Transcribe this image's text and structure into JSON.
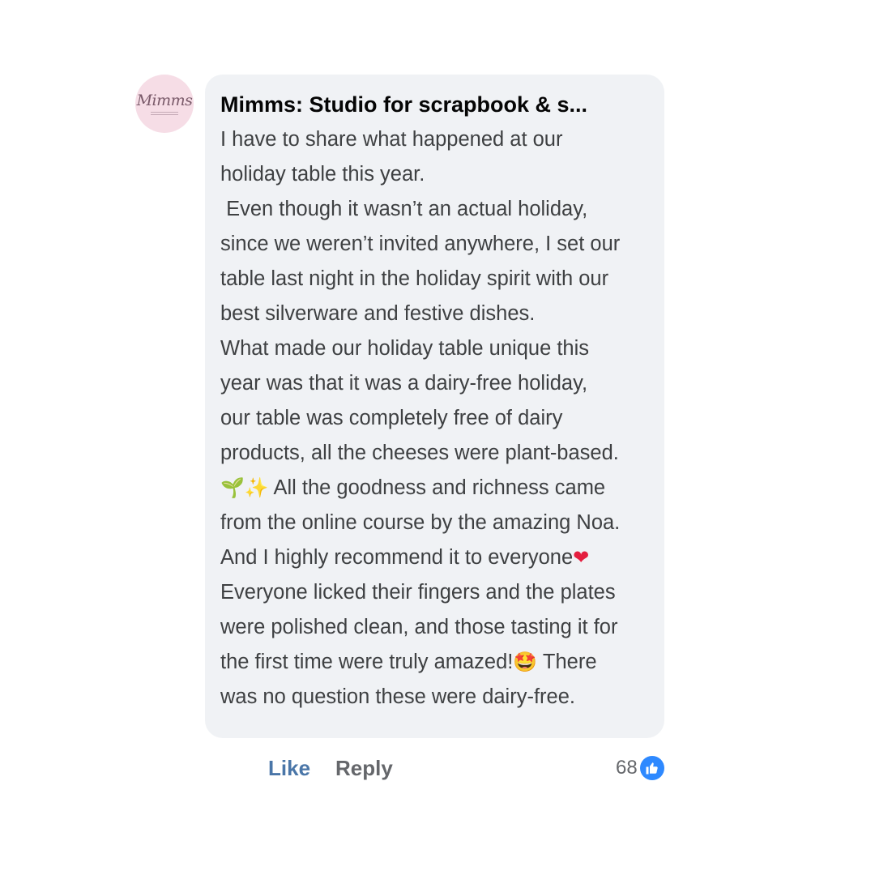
{
  "comment": {
    "avatar": {
      "logo_text": "Mimms",
      "icon": "brand-logo-avatar",
      "background": "#f6dde6"
    },
    "author": "Mimms: Studio for scrapbook & s...",
    "lines": [
      "I have to share what happened at our",
      "holiday table this year.",
      " Even though it wasn’t an actual holiday,",
      "since we weren’t invited anywhere, I set our",
      "table last night in the holiday spirit with our",
      "best silverware and festive dishes.",
      "What made our holiday table unique this",
      "year was that it was a dairy-free holiday,",
      "our table was completely free of dairy",
      "products, all the cheeses were plant-based.",
      {
        "emojis": [
          "🌱",
          "✨"
        ],
        "text": " All the goodness and richness came"
      },
      "from the online course by the amazing Noa.",
      {
        "text": "And I highly recommend it to everyone",
        "emoji_after": "❤"
      },
      "Everyone licked their fingers and the plates",
      "were polished clean, and those tasting it for",
      {
        "text": "the first time were truly amazed!",
        "emoji_after": "🤩",
        "text_after": " There"
      },
      "was no question these were dairy-free."
    ]
  },
  "actions": {
    "like_label": "Like",
    "reply_label": "Reply"
  },
  "reactions": {
    "count": "68",
    "icon": "thumbs-up-icon",
    "badge_color": "#2e89ff"
  }
}
